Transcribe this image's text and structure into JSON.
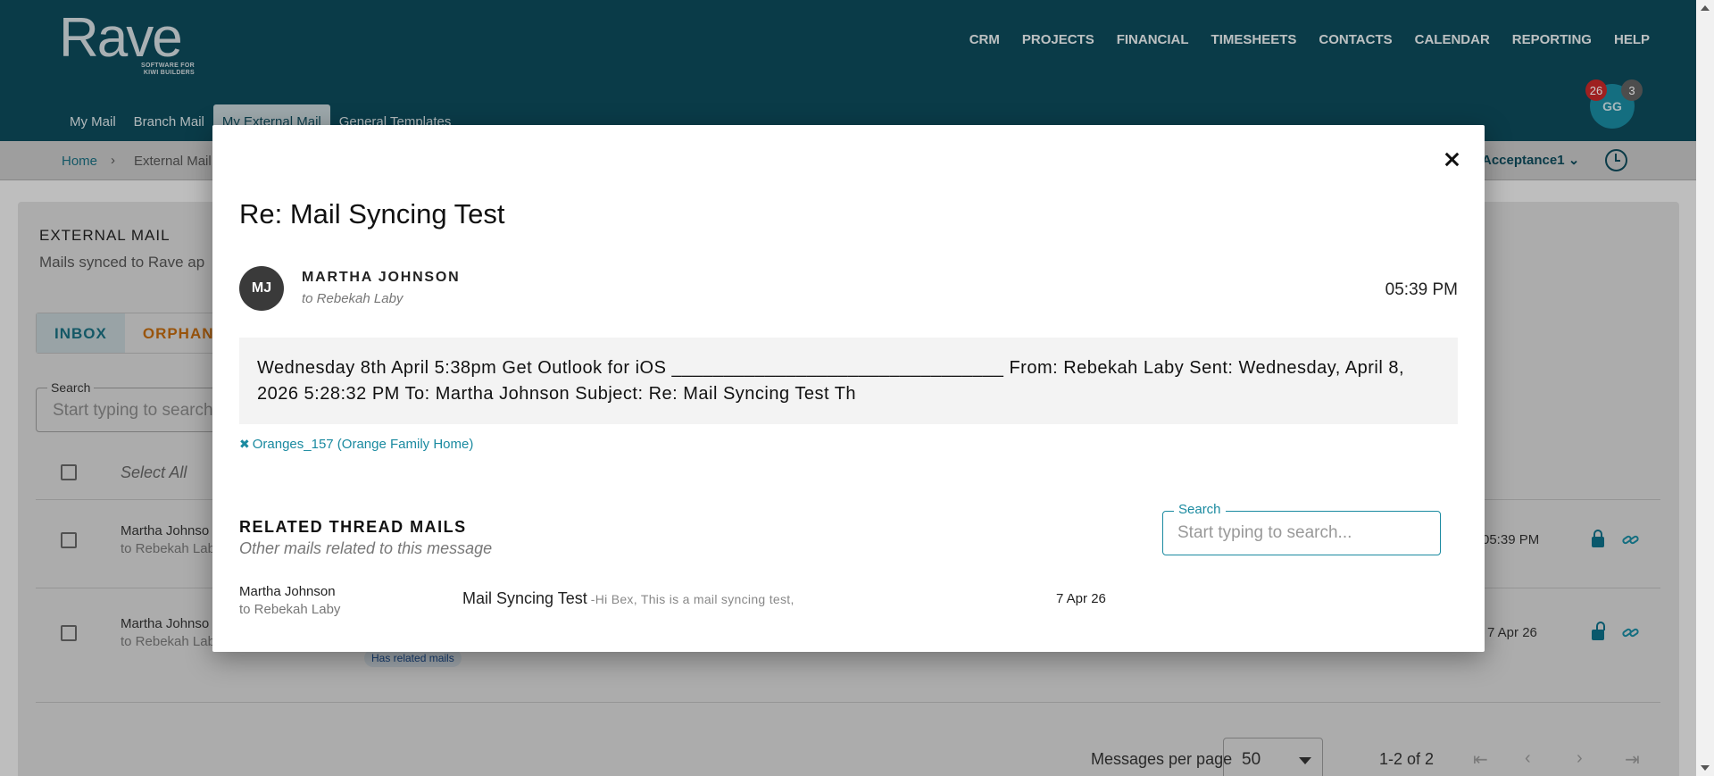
{
  "brand": {
    "name": "Rave",
    "tagline": "SOFTWARE FOR KIWI BUILDERS",
    "color": "#0d4a5b"
  },
  "main_nav": [
    "CRM",
    "PROJECTS",
    "FINANCIAL",
    "TIMESHEETS",
    "CONTACTS",
    "CALENDAR",
    "REPORTING",
    "HELP"
  ],
  "sub_nav": [
    "My Mail",
    "Branch Mail",
    "My External Mail",
    "General Templates"
  ],
  "user": {
    "initials": "GG",
    "badge_count_red": "26",
    "badge_count_grey": "3"
  },
  "breadcrumb": {
    "home": "Home",
    "separator": "›",
    "current": "External Mail"
  },
  "account": {
    "label": "Acceptance1"
  },
  "page": {
    "title": "EXTERNAL MAIL",
    "subtitle": "Mails synced to Rave ap",
    "tabs": [
      "INBOX",
      "ORPHAN"
    ],
    "search_label": "Search",
    "search_placeholder": "Start typing to search",
    "select_all": "Select All",
    "rows": [
      {
        "from": "Martha Johnso",
        "to": "to Rebekah Lab",
        "time": "05:39 PM"
      },
      {
        "from": "Martha Johnso",
        "to": "to Rebekah Lab",
        "time": "7 Apr 26",
        "chip": "Has related mails"
      }
    ],
    "pager": {
      "label": "Messages per page",
      "per_page": "50",
      "count": "1-2 of 2"
    }
  },
  "modal": {
    "title": "Re: Mail Syncing Test",
    "sender_initials": "MJ",
    "sender": "MARTHA JOHNSON",
    "recipient": "to  Rebekah Laby",
    "time": "05:39 PM",
    "body": "Wednesday 8th April 5:38pm  Get Outlook for iOS ________________________________ From: Rebekah Laby  Sent: Wednesday, April 8, 2026 5:28:32 PM To: Martha Johnson  Subject: Re: Mail Syncing Test  Th",
    "project": "Oranges_157 (Orange Family Home)",
    "related": {
      "title": "RELATED THREAD MAILS",
      "subtitle": "Other mails related to this message",
      "search_label": "Search",
      "search_placeholder": "Start typing to search...",
      "mails": [
        {
          "from": "Martha Johnson",
          "to": "to Rebekah Laby",
          "subject": "Mail Syncing Test",
          "snippet": "-Hi Bex, This is a mail syncing test,",
          "date": "7 Apr 26"
        }
      ]
    }
  }
}
